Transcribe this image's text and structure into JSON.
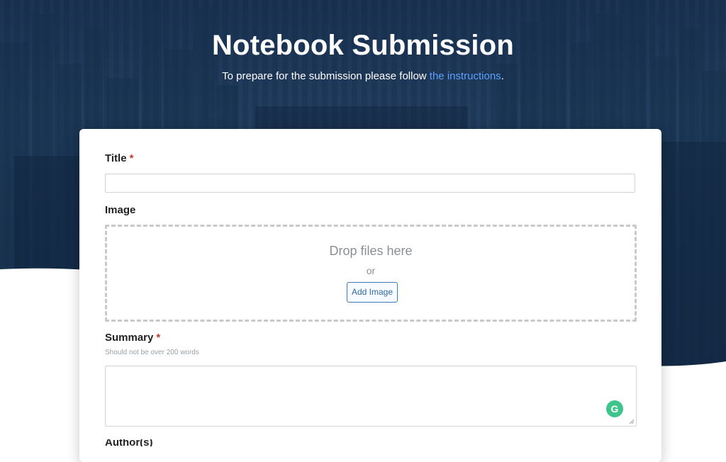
{
  "hero": {
    "title": "Notebook Submission",
    "subtitle_prefix": "To prepare for the submission please follow ",
    "subtitle_link": "the instructions",
    "subtitle_suffix": "."
  },
  "form": {
    "title_field": {
      "label": "Title",
      "required_mark": "*",
      "value": ""
    },
    "image_field": {
      "label": "Image",
      "drop_text": "Drop files here",
      "or_text": "or",
      "button_label": "Add Image"
    },
    "summary_field": {
      "label": "Summary",
      "required_mark": "*",
      "hint": "Should not be over 200 words",
      "value": ""
    },
    "next_field_label": "Author(s)"
  },
  "colors": {
    "link": "#5aa0ff",
    "required": "#c0392b",
    "button_border": "#3d78b8",
    "grammarly": "#3ec58c"
  },
  "icons": {
    "grammarly": "grammarly-icon",
    "resize": "resize-handle-icon"
  }
}
